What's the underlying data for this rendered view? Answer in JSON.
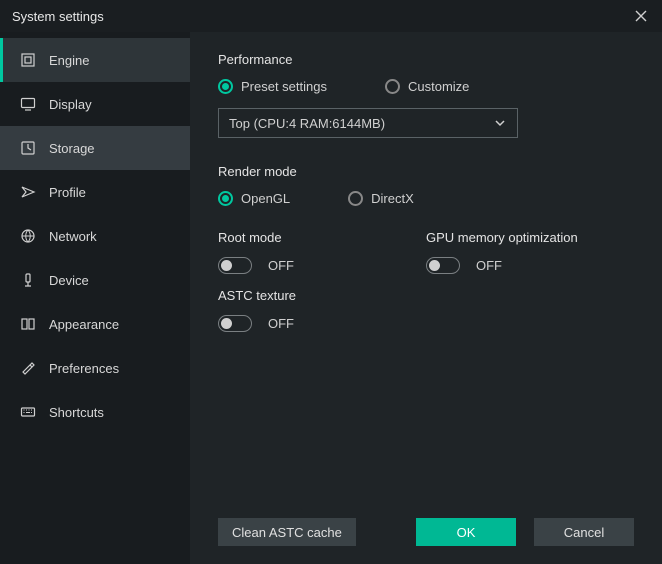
{
  "title": "System settings",
  "sidebar": {
    "items": [
      {
        "label": "Engine"
      },
      {
        "label": "Display"
      },
      {
        "label": "Storage"
      },
      {
        "label": "Profile"
      },
      {
        "label": "Network"
      },
      {
        "label": "Device"
      },
      {
        "label": "Appearance"
      },
      {
        "label": "Preferences"
      },
      {
        "label": "Shortcuts"
      }
    ]
  },
  "performance": {
    "title": "Performance",
    "preset": "Preset settings",
    "customize": "Customize",
    "dropdown": "Top (CPU:4 RAM:6144MB)"
  },
  "render": {
    "title": "Render mode",
    "opengl": "OpenGL",
    "directx": "DirectX"
  },
  "root_mode": {
    "title": "Root mode",
    "state": "OFF"
  },
  "gpu_mem": {
    "title": "GPU memory optimization",
    "state": "OFF"
  },
  "astc": {
    "title": "ASTC texture",
    "state": "OFF"
  },
  "buttons": {
    "clean": "Clean ASTC cache",
    "ok": "OK",
    "cancel": "Cancel"
  }
}
